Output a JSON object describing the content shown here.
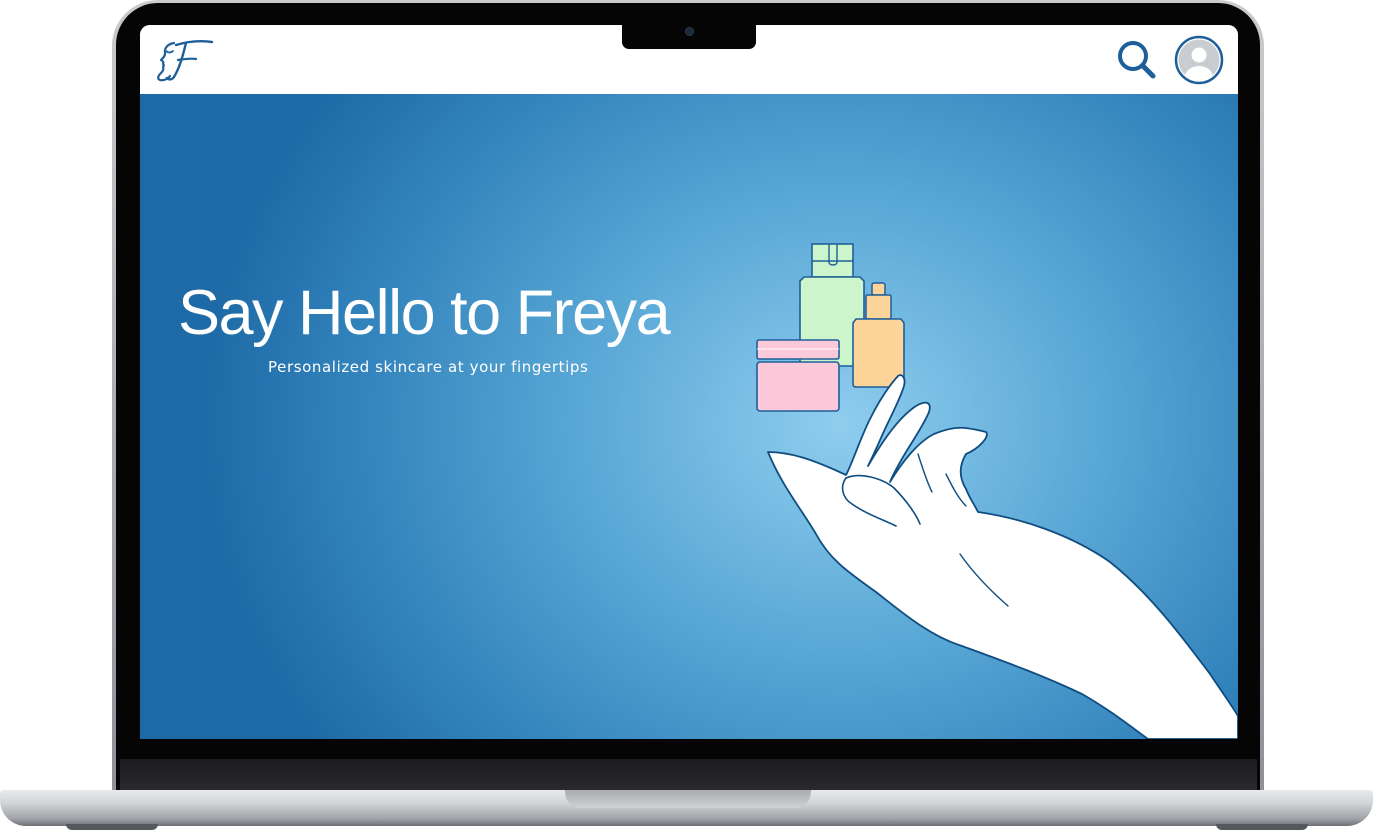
{
  "app": {
    "brand": "Freya",
    "logo_letter": "F"
  },
  "header": {
    "search_icon": "search-icon",
    "profile_icon": "user-avatar-icon"
  },
  "hero": {
    "title": "Say Hello to Freya",
    "subtitle": "Personalized skincare at your fingertips",
    "illustration": "hand-holding-skincare-products"
  },
  "colors": {
    "brand_blue": "#1e5f99",
    "hero_light": "#8fcdee",
    "hero_dark": "#1e6aa6",
    "product_green": "#ccf5cc",
    "product_peach": "#fdd59a",
    "product_pink": "#fbc9d9"
  }
}
